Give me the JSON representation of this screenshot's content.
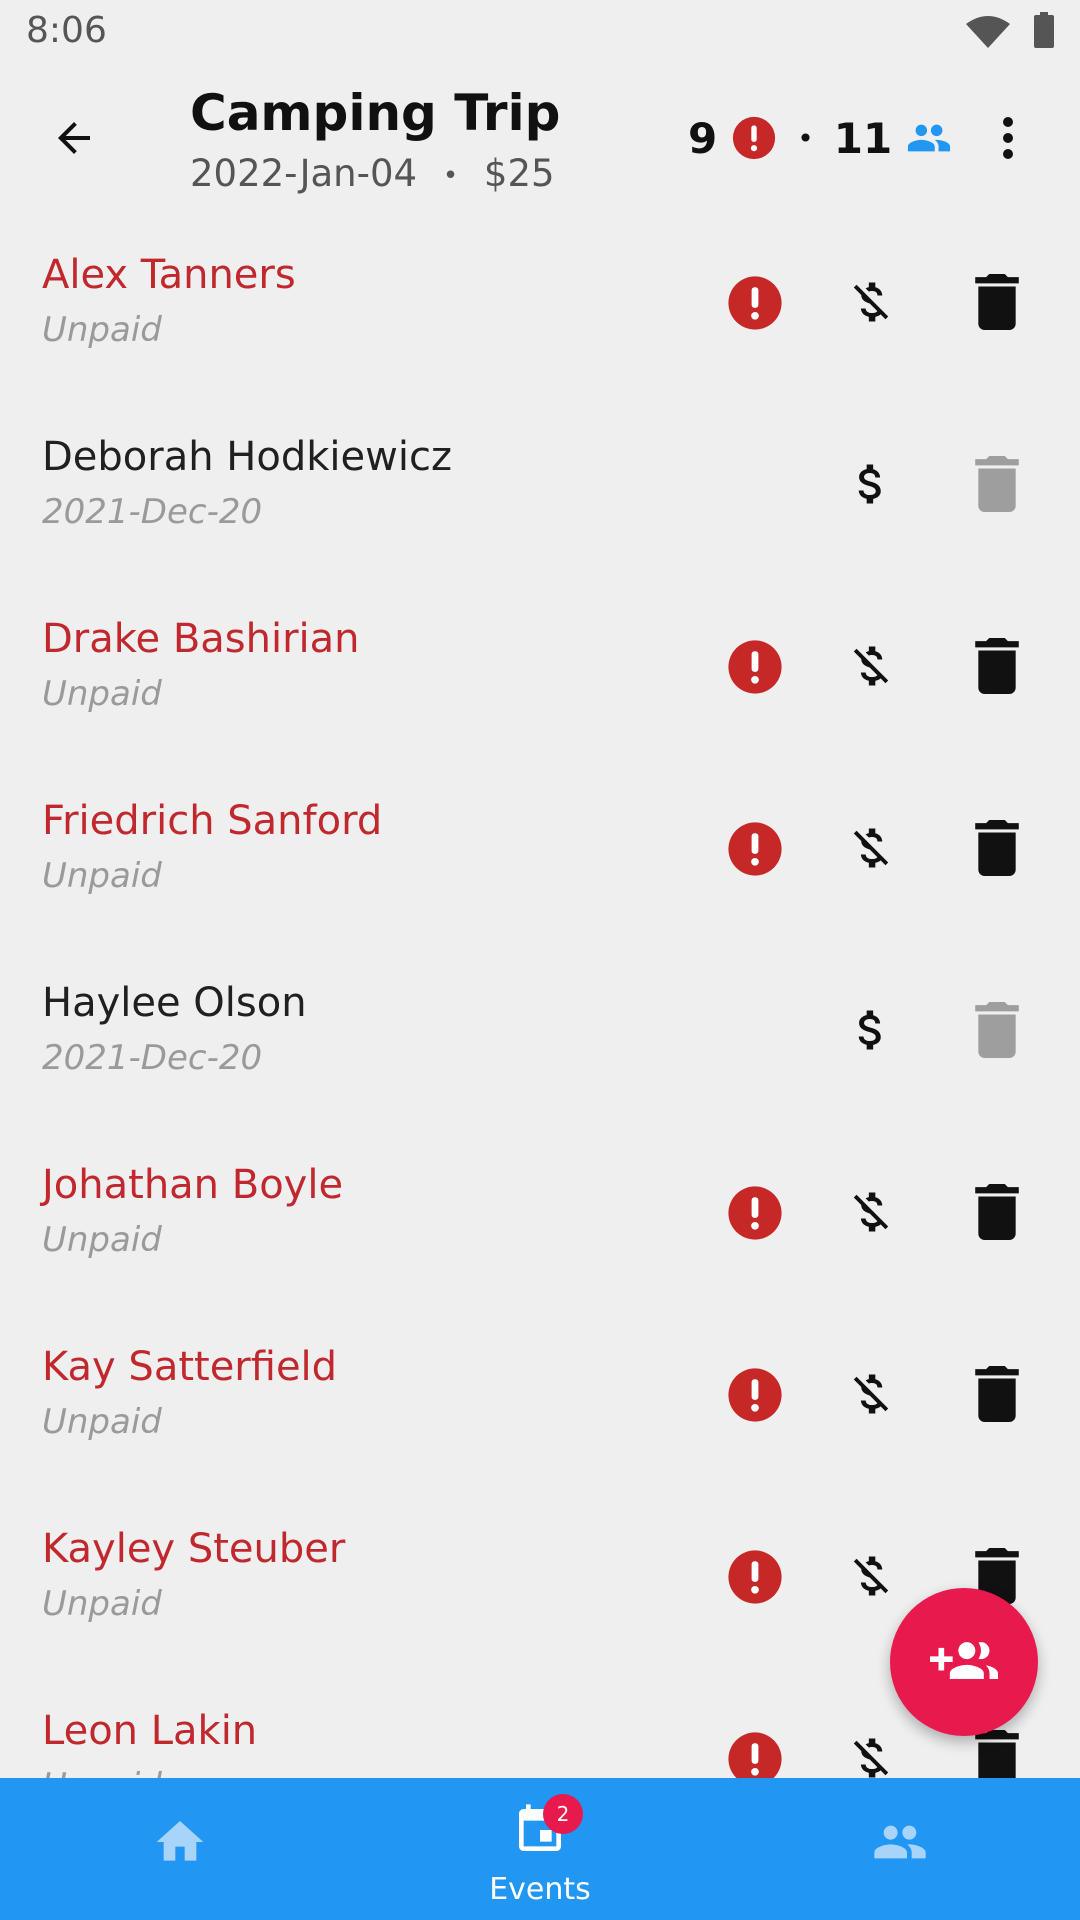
{
  "status_bar": {
    "time": "8:06"
  },
  "header": {
    "title": "Camping Trip",
    "date": "2022-Jan-04",
    "separator": "•",
    "price": "$25",
    "unpaid_count": "9",
    "dot": "•",
    "member_count": "11"
  },
  "colors": {
    "unpaid_red": "#c0282d",
    "alert_red": "#c62828",
    "accent_pink": "#e8194d",
    "nav_blue": "#2196f3",
    "people_blue": "#2196f3",
    "disabled_gray": "#9e9e9e"
  },
  "participants": [
    {
      "name": "Alex Tanners",
      "status": "Unpaid",
      "paid": false
    },
    {
      "name": "Deborah Hodkiewicz",
      "status": "2021-Dec-20",
      "paid": true
    },
    {
      "name": "Drake Bashirian",
      "status": "Unpaid",
      "paid": false
    },
    {
      "name": "Friedrich Sanford",
      "status": "Unpaid",
      "paid": false
    },
    {
      "name": "Haylee Olson",
      "status": "2021-Dec-20",
      "paid": true
    },
    {
      "name": "Johathan Boyle",
      "status": "Unpaid",
      "paid": false
    },
    {
      "name": "Kay Satterfield",
      "status": "Unpaid",
      "paid": false
    },
    {
      "name": "Kayley Steuber",
      "status": "Unpaid",
      "paid": false
    },
    {
      "name": "Leon Lakin",
      "status": "Unpaid",
      "paid": false
    }
  ],
  "icons": {
    "back": "arrow-back-icon",
    "alert": "alert-circle-icon",
    "people": "people-icon",
    "more": "more-vert-icon",
    "money_off": "money-off-icon",
    "money": "dollar-icon",
    "delete": "trash-icon",
    "fab": "group-add-icon"
  },
  "bottom_nav": {
    "home_label": "",
    "events_label": "Events",
    "events_badge": "2",
    "people_label": ""
  }
}
